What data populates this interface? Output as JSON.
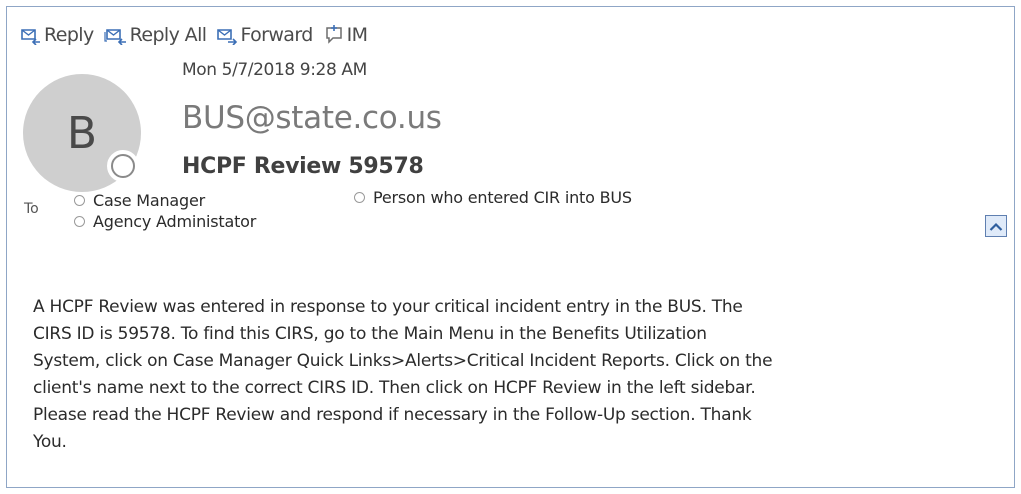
{
  "toolbar": {
    "reply_label": "Reply",
    "reply_all_label": "Reply All",
    "forward_label": "Forward",
    "im_label": "IM"
  },
  "message": {
    "date": "Mon 5/7/2018 9:28 AM",
    "avatar_initial": "B",
    "sender": "BUS@state.co.us",
    "subject": "HCPF Review 59578",
    "to_label": "To",
    "recipients": [
      "Case Manager",
      "Agency Administator",
      "Person who entered CIR into BUS"
    ],
    "body_lines": [
      "A HCPF Review was entered in response to your critical incident entry in the BUS. The",
      "CIRS ID  is 59578. To find this CIRS, go to the Main Menu in the Benefits Utilization",
      "System, click on Case Manager Quick Links>Alerts>Critical Incident Reports. Click on the",
      "client's name next to the correct CIRS ID. Then click on HCPF Review in the left sidebar.",
      "Please read the HCPF Review and respond if necessary in the Follow-Up section. Thank",
      "You."
    ]
  },
  "icons": {
    "reply": "reply-icon",
    "reply_all": "reply-all-icon",
    "forward": "forward-icon",
    "im": "im-icon",
    "expand": "chevron-up-icon"
  },
  "colors": {
    "frame_border": "#8fa6c6",
    "icon_blue": "#3c6fb6",
    "avatar_bg": "#cfcfcf",
    "sender_text": "#7a7a7a"
  }
}
